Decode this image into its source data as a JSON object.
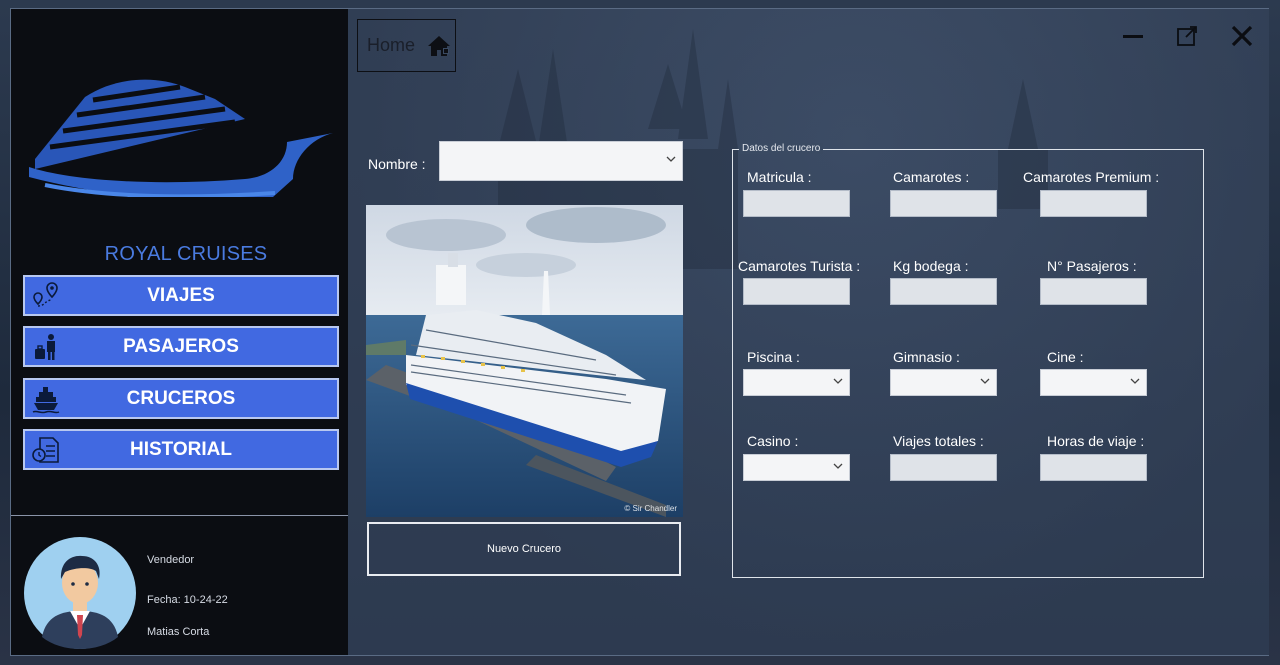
{
  "sidebar": {
    "brand": "ROYAL CRUISES",
    "nav": [
      {
        "label": "VIAJES",
        "icon": "map-pin-route-icon"
      },
      {
        "label": "PASAJEROS",
        "icon": "passenger-luggage-icon"
      },
      {
        "label": "CRUCEROS",
        "icon": "ship-icon"
      },
      {
        "label": "HISTORIAL",
        "icon": "history-document-icon"
      }
    ],
    "user": {
      "role": "Vendedor",
      "date": "Fecha: 10-24-22",
      "name": "Matias Corta"
    }
  },
  "header": {
    "home_label": "Home"
  },
  "form": {
    "nombre_label": "Nombre :",
    "nombre_value": "",
    "photo_credit": "© Sir Chandler",
    "new_button": "Nuevo Crucero"
  },
  "details": {
    "group_title": "Datos del crucero",
    "fields": {
      "matricula": "Matricula :",
      "camarotes": "Camarotes :",
      "camarotes_premium": "Camarotes Premium :",
      "camarotes_turista": "Camarotes Turista :",
      "kg_bodega": "Kg bodega :",
      "n_pasajeros": "N° Pasajeros :",
      "piscina": "Piscina :",
      "gimnasio": "Gimnasio :",
      "cine": "Cine :",
      "casino": "Casino :",
      "viajes_totales": "Viajes totales :",
      "horas_viaje": "Horas de viaje :"
    }
  },
  "colors": {
    "accent": "#4169e1",
    "sidebar_bg": "#0b0d12",
    "brand_text": "#4a7be0"
  }
}
